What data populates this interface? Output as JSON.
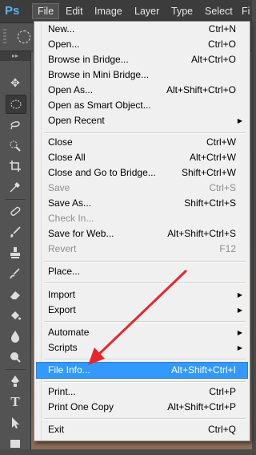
{
  "app": {
    "logo": "Ps"
  },
  "menubar": {
    "items": [
      {
        "label": "File"
      },
      {
        "label": "Edit"
      },
      {
        "label": "Image"
      },
      {
        "label": "Layer"
      },
      {
        "label": "Type"
      },
      {
        "label": "Select"
      },
      {
        "label": "Fi"
      }
    ]
  },
  "file_menu": {
    "items": [
      {
        "label": "New...",
        "shortcut": "Ctrl+N"
      },
      {
        "label": "Open...",
        "shortcut": "Ctrl+O"
      },
      {
        "label": "Browse in Bridge...",
        "shortcut": "Alt+Ctrl+O"
      },
      {
        "label": "Browse in Mini Bridge...",
        "shortcut": ""
      },
      {
        "label": "Open As...",
        "shortcut": "Alt+Shift+Ctrl+O"
      },
      {
        "label": "Open as Smart Object...",
        "shortcut": ""
      },
      {
        "label": "Open Recent",
        "shortcut": ""
      },
      {
        "label": "Close",
        "shortcut": "Ctrl+W"
      },
      {
        "label": "Close All",
        "shortcut": "Alt+Ctrl+W"
      },
      {
        "label": "Close and Go to Bridge...",
        "shortcut": "Shift+Ctrl+W"
      },
      {
        "label": "Save",
        "shortcut": "Ctrl+S"
      },
      {
        "label": "Save As...",
        "shortcut": "Shift+Ctrl+S"
      },
      {
        "label": "Check In...",
        "shortcut": ""
      },
      {
        "label": "Save for Web...",
        "shortcut": "Alt+Shift+Ctrl+S"
      },
      {
        "label": "Revert",
        "shortcut": "F12"
      },
      {
        "label": "Place...",
        "shortcut": ""
      },
      {
        "label": "Import",
        "shortcut": ""
      },
      {
        "label": "Export",
        "shortcut": ""
      },
      {
        "label": "Automate",
        "shortcut": ""
      },
      {
        "label": "Scripts",
        "shortcut": ""
      },
      {
        "label": "File Info...",
        "shortcut": "Alt+Shift+Ctrl+I"
      },
      {
        "label": "Print...",
        "shortcut": "Ctrl+P"
      },
      {
        "label": "Print One Copy",
        "shortcut": "Alt+Shift+Ctrl+P"
      },
      {
        "label": "Exit",
        "shortcut": "Ctrl+Q"
      }
    ]
  },
  "colors": {
    "highlight": "#3399ff",
    "annotation": "#e8262a",
    "logo": "#5ab4f0"
  }
}
